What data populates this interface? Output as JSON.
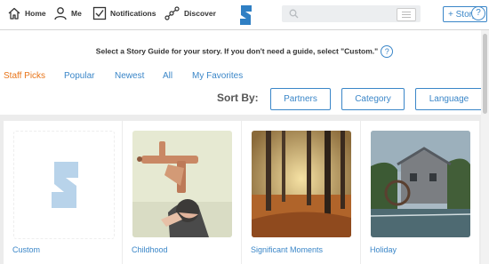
{
  "nav": {
    "home_label": "Home",
    "me_label": "Me",
    "notifications_label": "Notifications",
    "discover_label": "Discover"
  },
  "search": {
    "placeholder": ""
  },
  "story_button_label": "+ Story",
  "help_glyph": "?",
  "instruction": "Select a Story Guide for your story. If you don't need a guide, select \"Custom.\"",
  "tabs": [
    "Staff Picks",
    "Popular",
    "Newest",
    "All",
    "My Favorites"
  ],
  "sort": {
    "label": "Sort By:",
    "buttons": [
      "Partners",
      "Category",
      "Language"
    ]
  },
  "guides": [
    "Custom",
    "Childhood",
    "Significant Moments",
    "Holiday"
  ],
  "colors": {
    "accent": "#3a86c8",
    "active_tab": "#e8751a"
  }
}
